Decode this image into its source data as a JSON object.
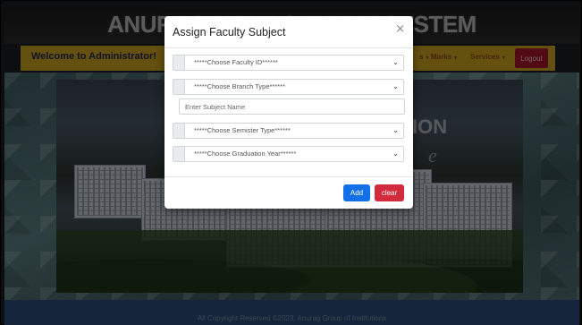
{
  "header": {
    "title": "ANURAG MANAGEMENT SYSTEM"
  },
  "nav": {
    "welcome": "Welcome to Administrator!",
    "items": [
      {
        "label": "s",
        "caret": "▾"
      },
      {
        "label": "Marks",
        "caret": "▾"
      },
      {
        "label": "Services",
        "caret": "▾"
      }
    ],
    "logout": "Logout"
  },
  "hero": {
    "overlay_text": "ION",
    "overlay_script": "e"
  },
  "footer": {
    "copyright": "All Copyright Reserved ©2023. Anurag Group of Institutions"
  },
  "modal": {
    "title": "Assign Faculty Subject",
    "close": "×",
    "faculty_select": "*****Choose Faculty ID******",
    "branch_select": "*****Choose Branch Type******",
    "subject_placeholder": "Enter Subject Name",
    "semester_select": "*****Choose Semister Type******",
    "year_select": "*****Choose Graduation Year******",
    "chevron": "⌄",
    "add_label": "Add",
    "clear_label": "clear"
  },
  "colors": {
    "nav_bg": "#c9a21f",
    "logout_bg": "#a5152a",
    "footer_bg": "#2b4a78",
    "add_btn": "#1470e8",
    "clear_btn": "#d42a3e"
  }
}
